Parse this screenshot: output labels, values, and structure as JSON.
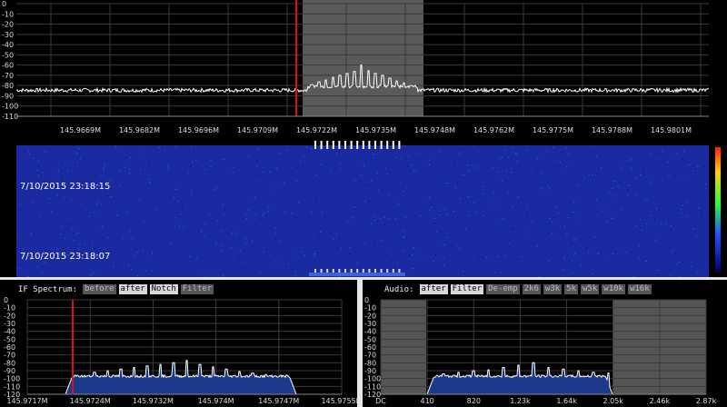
{
  "main_spectrum": {
    "y_ticks": [
      "0",
      "-10",
      "-20",
      "-30",
      "-40",
      "-50",
      "-60",
      "-70",
      "-80",
      "-90",
      "-100",
      "-110"
    ],
    "x_ticks": [
      "145.9669M",
      "145.9682M",
      "145.9696M",
      "145.9709M",
      "145.9722M",
      "145.9735M",
      "145.9748M",
      "145.9762M",
      "145.9775M",
      "145.9788M",
      "145.9801M"
    ],
    "colors": {
      "trace": "#ffffff",
      "grid": "#3a3a3a",
      "passband": "#5a5a5a",
      "marker": "#e01010"
    }
  },
  "waterfall": {
    "timestamps": [
      "7/10/2015 23:18:15",
      "7/10/2015 23:18:07"
    ],
    "colors": {
      "background": "#1a2aa0",
      "signal": "#ffffff"
    }
  },
  "if_spectrum": {
    "title": "IF Spectrum:",
    "buttons": [
      {
        "label": "before",
        "active": false
      },
      {
        "label": "after",
        "active": true
      },
      {
        "label": "Notch",
        "active": true
      },
      {
        "label": "Filter",
        "active": false
      }
    ],
    "y_ticks": [
      "0",
      "-10",
      "-20",
      "-30",
      "-40",
      "-50",
      "-60",
      "-70",
      "-80",
      "-90",
      "-100",
      "-110",
      "-120"
    ],
    "x_ticks": [
      "145.9717M",
      "145.9724M",
      "145.9732M",
      "145.974M",
      "145.9747M",
      "145.9755M"
    ]
  },
  "audio": {
    "title": "Audio:",
    "buttons": [
      {
        "label": "after",
        "active": true
      },
      {
        "label": "Filter",
        "active": true
      },
      {
        "label": "De-emp",
        "active": false
      },
      {
        "label": "2k6",
        "active": false
      },
      {
        "label": "w3k",
        "active": false
      },
      {
        "label": "5k",
        "active": false
      },
      {
        "label": "w5k",
        "active": false
      },
      {
        "label": "w10k",
        "active": false
      },
      {
        "label": "w16k",
        "active": false
      }
    ],
    "y_ticks": [
      "0",
      "-10",
      "-20",
      "-30",
      "-40",
      "-50",
      "-60",
      "-70",
      "-80",
      "-90",
      "-100",
      "-110",
      "-120"
    ],
    "x_ticks": [
      "DC",
      "410",
      "820",
      "1.23k",
      "1.64k",
      "2.05k",
      "2.46k",
      "2.87k"
    ]
  }
}
